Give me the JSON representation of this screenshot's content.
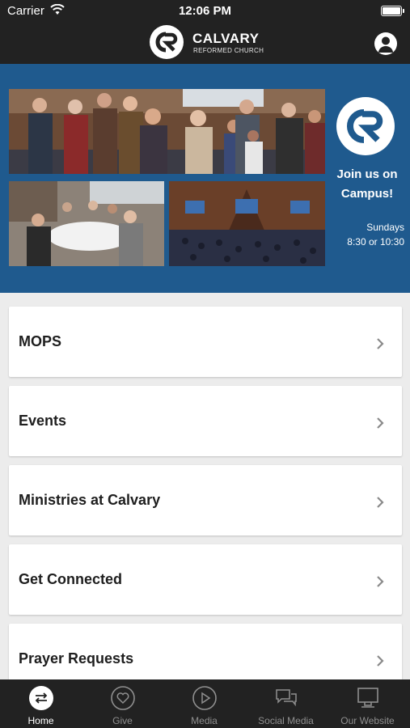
{
  "status_bar": {
    "carrier": "Carrier",
    "time": "12:06 PM"
  },
  "header": {
    "logo_text": "CR",
    "title": "CALVARY",
    "subtitle": "REFORMED CHURCH"
  },
  "banner": {
    "logo_text": "CR",
    "join_line1": "Join us on",
    "join_line2": "Campus!",
    "schedule_line1": "Sundays",
    "schedule_line2": "8:30 or 10:30"
  },
  "menu": {
    "items": [
      {
        "label": "MOPS"
      },
      {
        "label": "Events"
      },
      {
        "label": "Ministries at Calvary"
      },
      {
        "label": "Get Connected"
      },
      {
        "label": "Prayer Requests"
      }
    ]
  },
  "tabs": [
    {
      "label": "Home",
      "icon": "home-icon",
      "active": true
    },
    {
      "label": "Give",
      "icon": "heart-icon",
      "active": false
    },
    {
      "label": "Media",
      "icon": "play-icon",
      "active": false
    },
    {
      "label": "Social Media",
      "icon": "chat-bubbles-icon",
      "active": false
    },
    {
      "label": "Our Website",
      "icon": "computer-icon",
      "active": false
    }
  ],
  "colors": {
    "header_bg": "#222222",
    "banner_bg": "#1f5a8e",
    "page_bg": "#ececec",
    "tab_inactive": "#8f8f8f"
  }
}
